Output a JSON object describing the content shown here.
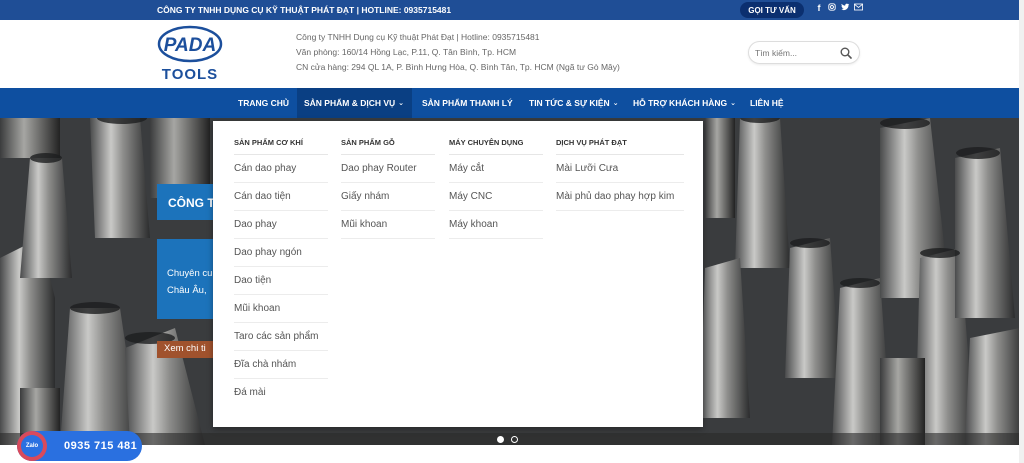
{
  "topbar": {
    "text": "CÔNG TY TNHH DỤNG CỤ KỸ THUẬT PHÁT ĐẠT | HOTLINE: 0935715481",
    "consult_button": "GỌI TƯ VẤN",
    "social_icons": [
      "facebook-icon",
      "instagram-icon",
      "twitter-icon",
      "mail-icon"
    ]
  },
  "header": {
    "logo_top": "PADA",
    "logo_bottom": "TOOLS",
    "info_lines": [
      "Công ty TNHH Dụng cụ Kỹ thuật Phát Đạt | Hotline: 0935715481",
      "Văn phòng: 160/14 Hồng Lạc, P.11, Q. Tân Bình, Tp. HCM",
      "CN cửa hàng: 294 QL 1A, P. Bình Hưng Hòa, Q. Bình Tân, Tp. HCM (Ngã tư Gò Mây)"
    ],
    "search_placeholder": "Tìm kiếm..."
  },
  "nav": {
    "items": [
      {
        "label": "TRANG CHỦ",
        "dropdown": false
      },
      {
        "label": "SẢN PHẨM & DỊCH VỤ",
        "dropdown": true
      },
      {
        "label": "SẢN PHẨM THANH LÝ",
        "dropdown": false
      },
      {
        "label": "TIN TỨC & SỰ KIỆN",
        "dropdown": true
      },
      {
        "label": "HỖ TRỢ KHÁCH HÀNG",
        "dropdown": true
      },
      {
        "label": "LIÊN HỆ",
        "dropdown": false
      }
    ]
  },
  "mega_menu": {
    "columns": [
      {
        "heading": "SẢN PHẨM CƠ KHÍ",
        "items": [
          "Cán dao phay",
          "Cán dao tiện",
          "Dao phay",
          "Dao phay ngón",
          "Dao tiện",
          "Mũi khoan",
          "Taro các sản phẩm",
          "Đĩa chà nhám",
          "Đá mài"
        ]
      },
      {
        "heading": "SẢN PHẨM GỖ",
        "items": [
          "Dao phay Router",
          "Giấy nhám",
          "Mũi khoan"
        ]
      },
      {
        "heading": "MÁY CHUYÊN DỤNG",
        "items": [
          "Máy cắt",
          "Máy CNC",
          "Máy khoan"
        ]
      },
      {
        "heading": "DỊCH VỤ PHÁT ĐẠT",
        "items": [
          "Mài Lưỡi Cưa",
          "Mài phủ dao phay hợp kim"
        ]
      }
    ]
  },
  "hero": {
    "title_visible": "CÔNG T",
    "desc_line1": "Chuyên cu",
    "desc_line2": "Châu Âu,",
    "button_visible": "Xem chi ti",
    "slide_count": 2,
    "active_slide": 1
  },
  "zalo": {
    "badge": "Zalo",
    "phone": "0935 715 481"
  }
}
